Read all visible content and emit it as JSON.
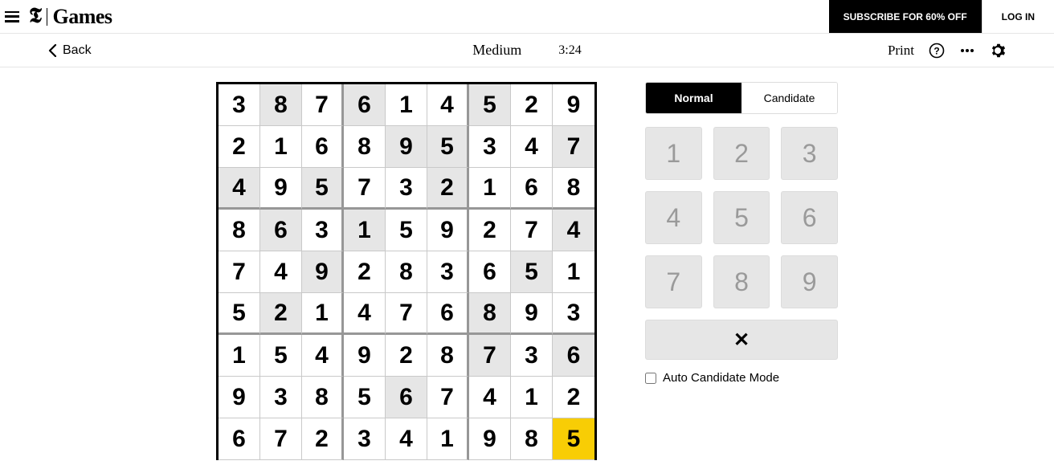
{
  "header": {
    "logo_letter": "𝕿",
    "logo_word": "Games",
    "subscribe_label": "SUBSCRIBE FOR 60% OFF",
    "login_label": "LOG IN"
  },
  "subheader": {
    "back_label": "Back",
    "difficulty": "Medium",
    "timer": "3:24",
    "print_label": "Print"
  },
  "controls": {
    "mode_normal": "Normal",
    "mode_candidate": "Candidate",
    "keys": [
      "1",
      "2",
      "3",
      "4",
      "5",
      "6",
      "7",
      "8",
      "9"
    ],
    "clear_glyph": "✕",
    "auto_label": "Auto Candidate Mode"
  },
  "board": {
    "selected": [
      8,
      8
    ],
    "rows": [
      [
        {
          "v": "3",
          "g": false
        },
        {
          "v": "8",
          "g": true
        },
        {
          "v": "7",
          "g": false
        },
        {
          "v": "6",
          "g": true
        },
        {
          "v": "1",
          "g": false
        },
        {
          "v": "4",
          "g": false
        },
        {
          "v": "5",
          "g": true
        },
        {
          "v": "2",
          "g": false
        },
        {
          "v": "9",
          "g": false
        }
      ],
      [
        {
          "v": "2",
          "g": false
        },
        {
          "v": "1",
          "g": false
        },
        {
          "v": "6",
          "g": false
        },
        {
          "v": "8",
          "g": false
        },
        {
          "v": "9",
          "g": true
        },
        {
          "v": "5",
          "g": true
        },
        {
          "v": "3",
          "g": false
        },
        {
          "v": "4",
          "g": false
        },
        {
          "v": "7",
          "g": true
        }
      ],
      [
        {
          "v": "4",
          "g": true
        },
        {
          "v": "9",
          "g": false
        },
        {
          "v": "5",
          "g": true
        },
        {
          "v": "7",
          "g": false
        },
        {
          "v": "3",
          "g": false
        },
        {
          "v": "2",
          "g": true
        },
        {
          "v": "1",
          "g": false
        },
        {
          "v": "6",
          "g": false
        },
        {
          "v": "8",
          "g": false
        }
      ],
      [
        {
          "v": "8",
          "g": false
        },
        {
          "v": "6",
          "g": true
        },
        {
          "v": "3",
          "g": false
        },
        {
          "v": "1",
          "g": true
        },
        {
          "v": "5",
          "g": false
        },
        {
          "v": "9",
          "g": false
        },
        {
          "v": "2",
          "g": false
        },
        {
          "v": "7",
          "g": false
        },
        {
          "v": "4",
          "g": true
        }
      ],
      [
        {
          "v": "7",
          "g": false
        },
        {
          "v": "4",
          "g": false
        },
        {
          "v": "9",
          "g": true
        },
        {
          "v": "2",
          "g": false
        },
        {
          "v": "8",
          "g": false
        },
        {
          "v": "3",
          "g": false
        },
        {
          "v": "6",
          "g": false
        },
        {
          "v": "5",
          "g": true
        },
        {
          "v": "1",
          "g": false
        }
      ],
      [
        {
          "v": "5",
          "g": false
        },
        {
          "v": "2",
          "g": true
        },
        {
          "v": "1",
          "g": false
        },
        {
          "v": "4",
          "g": false
        },
        {
          "v": "7",
          "g": false
        },
        {
          "v": "6",
          "g": false
        },
        {
          "v": "8",
          "g": true
        },
        {
          "v": "9",
          "g": false
        },
        {
          "v": "3",
          "g": false
        }
      ],
      [
        {
          "v": "1",
          "g": false
        },
        {
          "v": "5",
          "g": false
        },
        {
          "v": "4",
          "g": false
        },
        {
          "v": "9",
          "g": false
        },
        {
          "v": "2",
          "g": false
        },
        {
          "v": "8",
          "g": false
        },
        {
          "v": "7",
          "g": true
        },
        {
          "v": "3",
          "g": false
        },
        {
          "v": "6",
          "g": true
        }
      ],
      [
        {
          "v": "9",
          "g": false
        },
        {
          "v": "3",
          "g": false
        },
        {
          "v": "8",
          "g": false
        },
        {
          "v": "5",
          "g": false
        },
        {
          "v": "6",
          "g": true
        },
        {
          "v": "7",
          "g": false
        },
        {
          "v": "4",
          "g": false
        },
        {
          "v": "1",
          "g": false
        },
        {
          "v": "2",
          "g": false
        }
      ],
      [
        {
          "v": "6",
          "g": false
        },
        {
          "v": "7",
          "g": false
        },
        {
          "v": "2",
          "g": false
        },
        {
          "v": "3",
          "g": false
        },
        {
          "v": "4",
          "g": false
        },
        {
          "v": "1",
          "g": false
        },
        {
          "v": "9",
          "g": false
        },
        {
          "v": "8",
          "g": false
        },
        {
          "v": "5",
          "g": false
        }
      ]
    ]
  }
}
